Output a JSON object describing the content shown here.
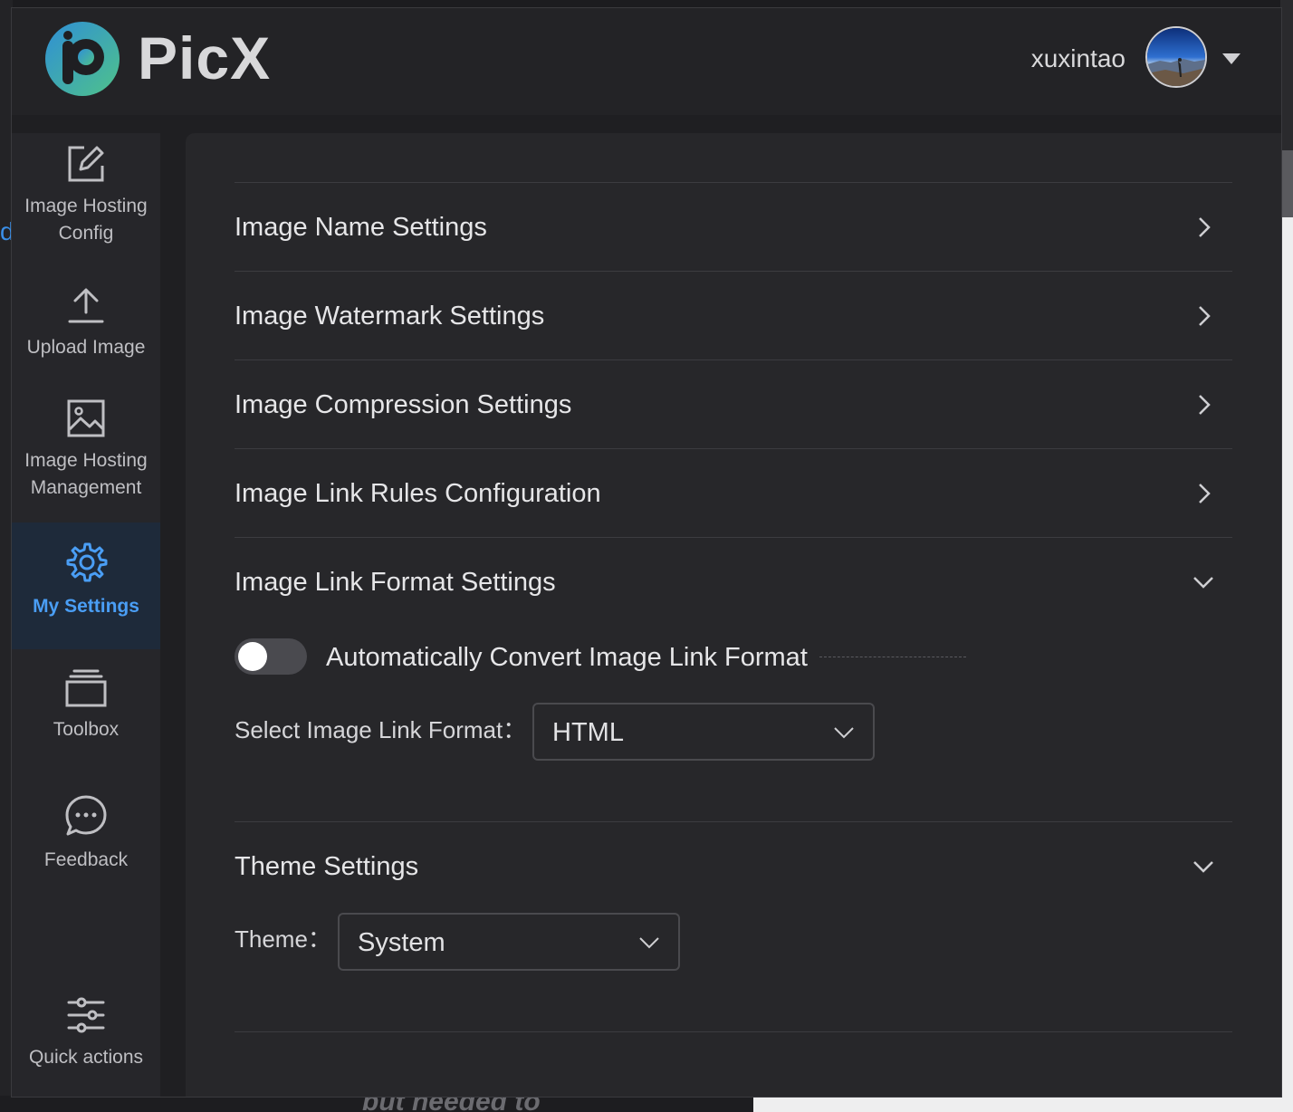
{
  "app": {
    "name": "PicX",
    "username": "xuxintao",
    "accent_color": "#4a9ef5"
  },
  "sidebar": {
    "items": [
      {
        "label_line1": "Image Hosting",
        "label_line2": "Config",
        "icon": "edit-icon"
      },
      {
        "label": "Upload Image",
        "icon": "upload-icon"
      },
      {
        "label_line1": "Image Hosting",
        "label_line2": "Management",
        "icon": "image-icon"
      },
      {
        "label": "My Settings",
        "icon": "gear-icon",
        "active": true
      },
      {
        "label": "Toolbox",
        "icon": "toolbox-icon"
      },
      {
        "label": "Feedback",
        "icon": "chat-icon"
      },
      {
        "label": "Quick actions",
        "icon": "sliders-icon"
      }
    ]
  },
  "settings": {
    "sections": [
      {
        "title": "Image Name Settings",
        "expanded": false
      },
      {
        "title": "Image Watermark Settings",
        "expanded": false
      },
      {
        "title": "Image Compression Settings",
        "expanded": false
      },
      {
        "title": "Image Link Rules Configuration",
        "expanded": false
      },
      {
        "title": "Image Link Format Settings",
        "expanded": true
      },
      {
        "title": "Theme Settings",
        "expanded": true
      }
    ],
    "link_format": {
      "auto_convert_label": "Automatically Convert Image Link Format",
      "auto_convert_enabled": false,
      "select_label": "Select Image Link Format：",
      "selected": "HTML"
    },
    "theme": {
      "label": "Theme：",
      "selected": "System"
    }
  },
  "background": {
    "bottom_text": "but needed to"
  }
}
